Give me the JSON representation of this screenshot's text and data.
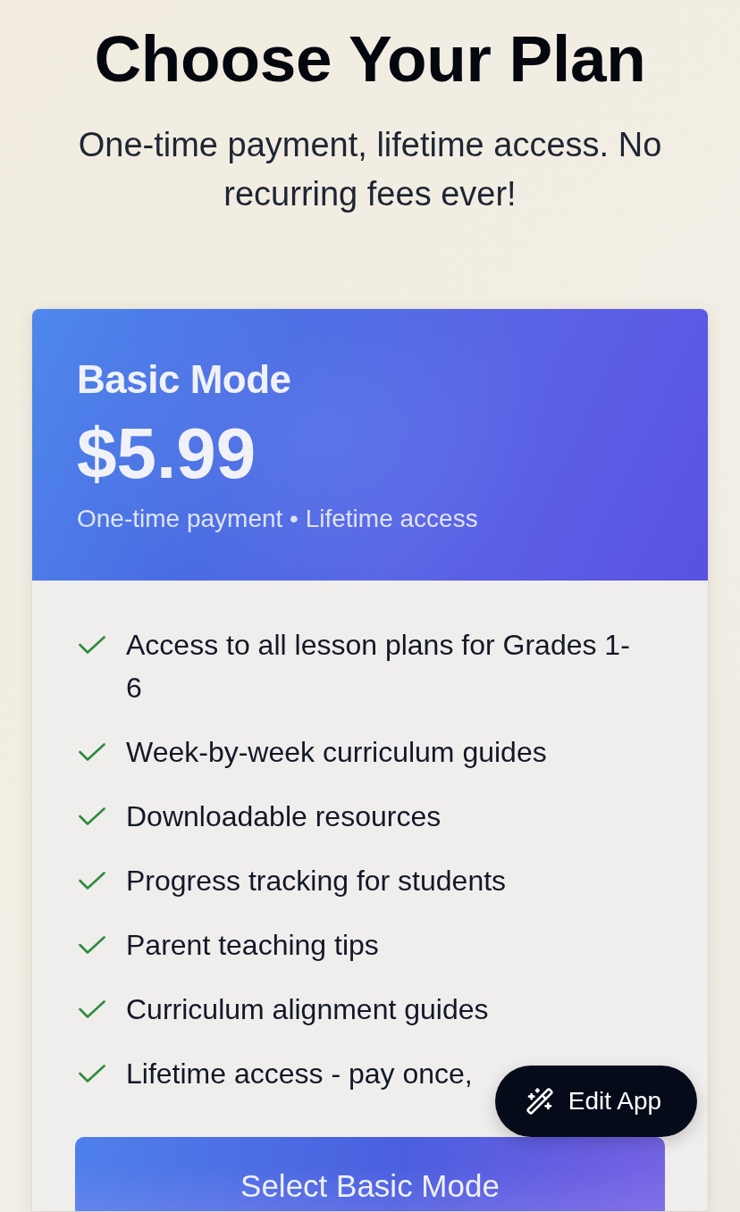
{
  "page": {
    "title": "Choose Your Plan",
    "subtitle": "One-time payment, lifetime access. No recurring fees ever!"
  },
  "plan": {
    "name": "Basic Mode",
    "price": "$5.99",
    "terms": "One-time payment • Lifetime access",
    "features": [
      "Access to all lesson plans for Grades 1-6",
      "Week-by-week curriculum guides",
      "Downloadable resources",
      "Progress tracking for students",
      "Parent teaching tips",
      "Curriculum alignment guides",
      "Lifetime access - pay once,"
    ],
    "select_button": "Select Basic Mode"
  },
  "edit_button": {
    "label": "Edit App"
  }
}
